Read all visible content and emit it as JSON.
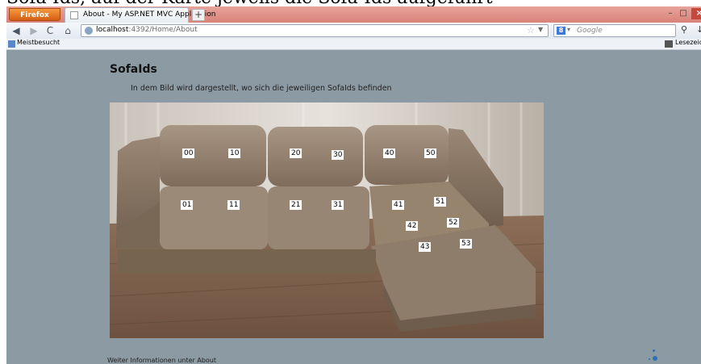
{
  "browser": {
    "firefox_button": "Firefox",
    "tab_title": "About - My ASP.NET MVC Application",
    "new_tab": "+",
    "window_controls": {
      "minimize": "–",
      "maximize": "□",
      "close": "×"
    },
    "url_host": "localhost",
    "url_path": ":4392/Home/About",
    "search_engine_letter": "8",
    "search_placeholder": "Google",
    "bookmarks_left": "Meistbesucht",
    "bookmarks_right": "Lesezeichen"
  },
  "page": {
    "title": "SofaIds",
    "description": "In dem Bild wird dargestellt, wo sich die jeweiligen SofaIds befinden",
    "footer": "Weiter Informationen unter  About"
  },
  "sofa_labels": [
    "00",
    "10",
    "20",
    "30",
    "40",
    "50",
    "01",
    "11",
    "21",
    "31",
    "41",
    "51",
    "42",
    "52",
    "43",
    "53"
  ],
  "colors": {
    "titlebar": "#d9837a",
    "page_background": "#8c9aa3",
    "firefox_orange": "#e36e1e"
  }
}
